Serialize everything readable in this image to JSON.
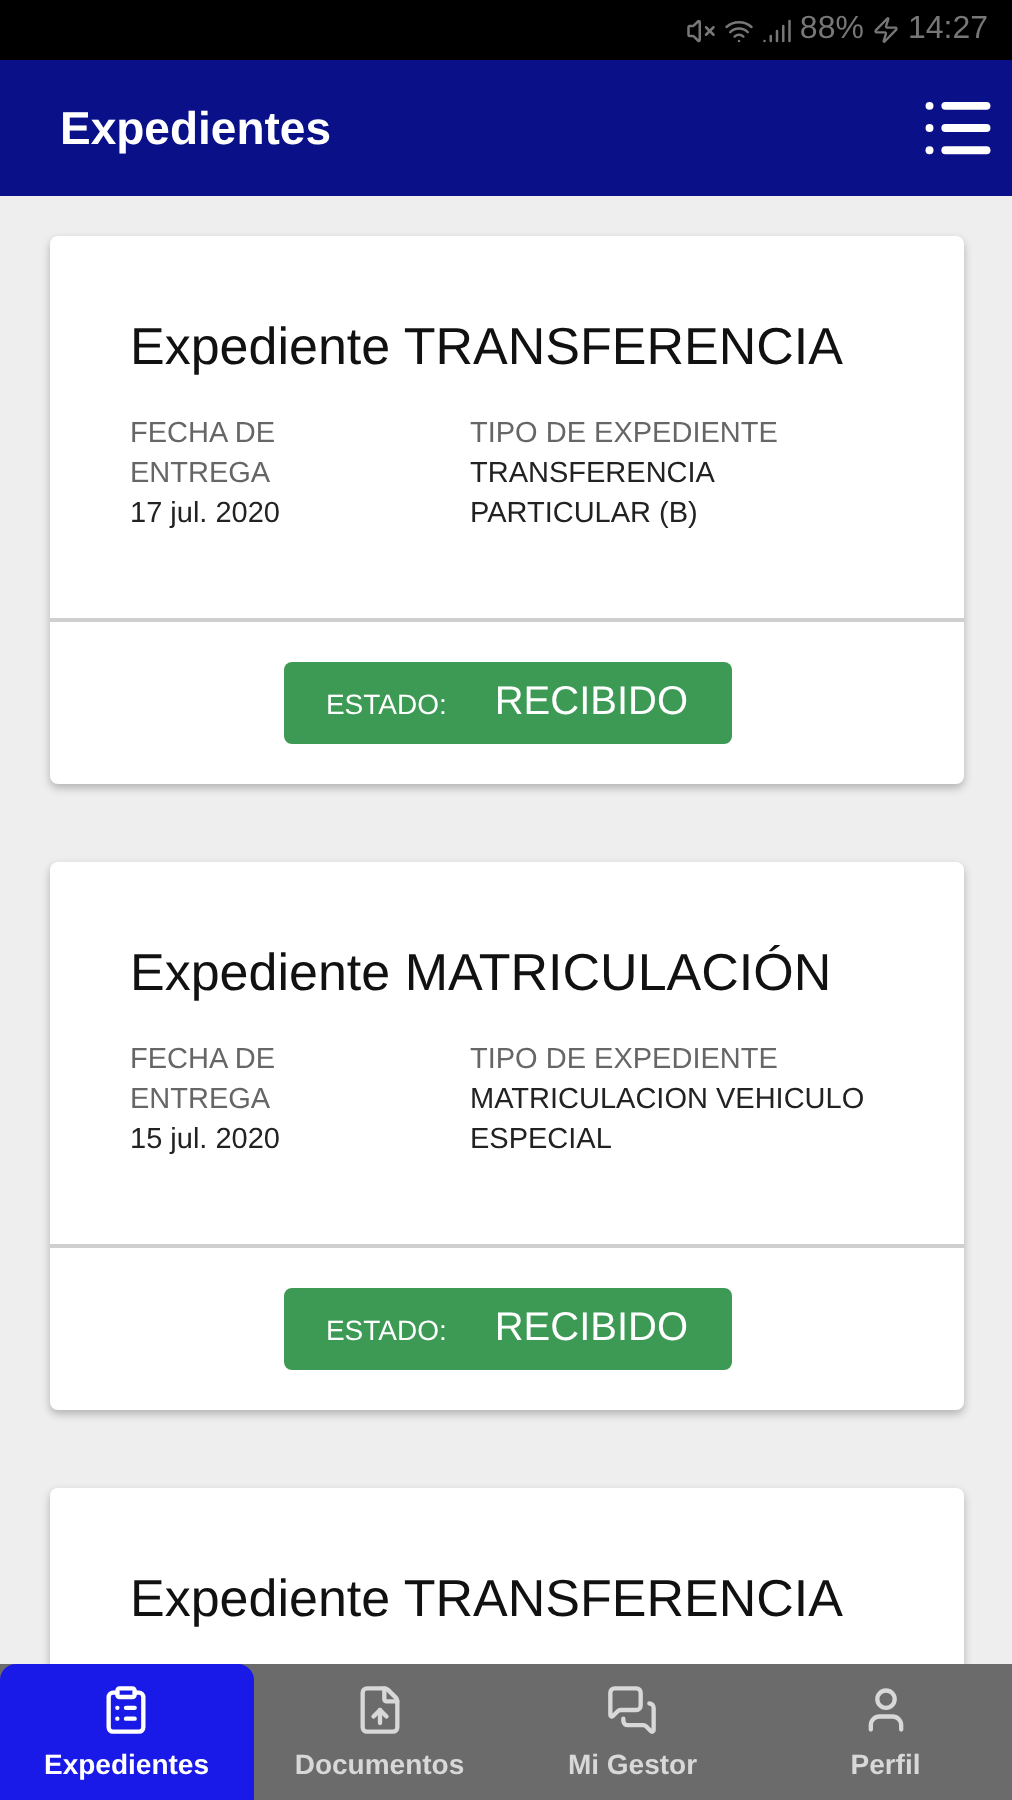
{
  "status_bar": {
    "battery": "88%",
    "time": "14:27"
  },
  "app_bar": {
    "title": "Expedientes"
  },
  "cards": [
    {
      "title": "Expediente TRANSFERENCIA",
      "date_label": "FECHA DE ENTREGA",
      "date": "17 jul. 2020",
      "type_label": "TIPO DE EXPEDIENTE",
      "type": "TRANSFERENCIA PARTICULAR (B)",
      "status_label": "ESTADO:",
      "status": "RECIBIDO"
    },
    {
      "title": "Expediente MATRICULACIÓN",
      "date_label": "FECHA DE ENTREGA",
      "date": "15 jul. 2020",
      "type_label": "TIPO DE EXPEDIENTE",
      "type": "MATRICULACION VEHICULO ESPECIAL",
      "status_label": "ESTADO:",
      "status": "RECIBIDO"
    },
    {
      "title": "Expediente TRANSFERENCIA"
    }
  ],
  "nav": [
    {
      "label": "Expedientes",
      "kind": "clipboard",
      "selected": true
    },
    {
      "label": "Documentos",
      "kind": "file",
      "selected": false
    },
    {
      "label": "Mi Gestor",
      "kind": "chat",
      "selected": false
    },
    {
      "label": "Perfil",
      "kind": "user",
      "selected": false
    }
  ]
}
